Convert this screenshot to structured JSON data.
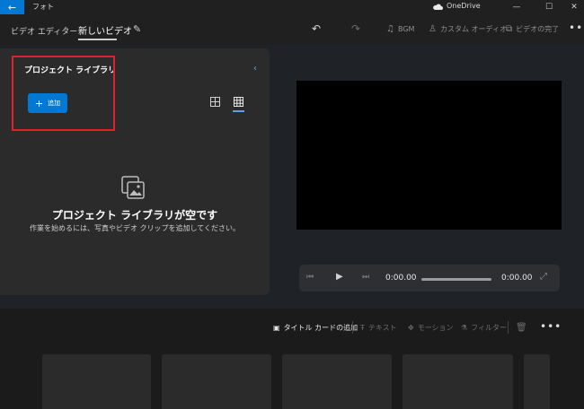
{
  "titlebar": {
    "app_title": "フォト",
    "onedrive": "OneDrive",
    "icons": {
      "back": "back-arrow-icon",
      "minimize": "minimize-icon",
      "maximize": "maximize-icon",
      "close": "close-icon"
    }
  },
  "toolbar": {
    "breadcrumb_root": "ビデオ エディター",
    "breadcrumb_current": "新しいビデオ",
    "bgm": "BGM",
    "custom_audio": "カスタム オーディオ",
    "finish_video": "ビデオの完了"
  },
  "library": {
    "title": "プロジェクト ライブラリ",
    "add_label": "追加",
    "empty_title": "プロジェクト ライブラリが空です",
    "empty_subtitle": "作業を始めるには、写真やビデオ クリップを追加してください。"
  },
  "player": {
    "current_time": "0:00.00",
    "total_time": "0:00.00"
  },
  "storyboard": {
    "title_card": "タイトル カードの追加",
    "text": "テキスト",
    "motion": "モーション",
    "filter": "フィルター"
  },
  "colors": {
    "accent": "#0078d4",
    "highlight_box": "#e0202a"
  }
}
